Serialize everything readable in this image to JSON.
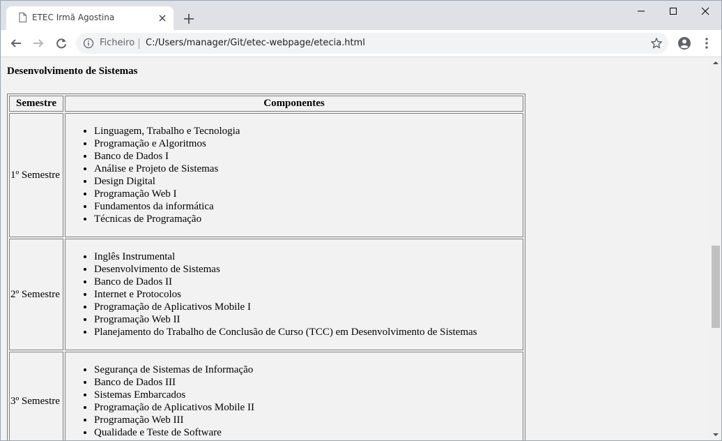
{
  "tab": {
    "title": "ETEC Irmã Agostina"
  },
  "omnibox": {
    "scheme": "Ficheiro",
    "url": "C:/Users/manager/Git/etec-webpage/etecia.html"
  },
  "page": {
    "heading": "Desenvolvimento de Sistemas",
    "table": {
      "headers": [
        "Semestre",
        "Componentes"
      ],
      "rows": [
        {
          "semester": "1º Semestre",
          "items": [
            "Linguagem, Trabalho e Tecnologia",
            "Programação e Algoritmos",
            "Banco de Dados I",
            "Análise e Projeto de Sistemas",
            "Design Digital",
            "Programação Web I",
            "Fundamentos da informática",
            "Técnicas de Programação"
          ]
        },
        {
          "semester": "2º Semestre",
          "items": [
            "Inglês Instrumental",
            "Desenvolvimento de Sistemas",
            "Banco de Dados II",
            "Internet e Protocolos",
            "Programação de Aplicativos Mobile I",
            "Programação Web II",
            "Planejamento do Trabalho de Conclusão de Curso (TCC) em Desenvolvimento de Sistemas"
          ]
        },
        {
          "semester": "3º Semestre",
          "items": [
            "Segurança de Sistemas de Informação",
            "Banco de Dados III",
            "Sistemas Embarcados",
            "Programação de Aplicativos Mobile II",
            "Programação Web III",
            "Qualidade e Teste de Software"
          ]
        }
      ]
    }
  }
}
